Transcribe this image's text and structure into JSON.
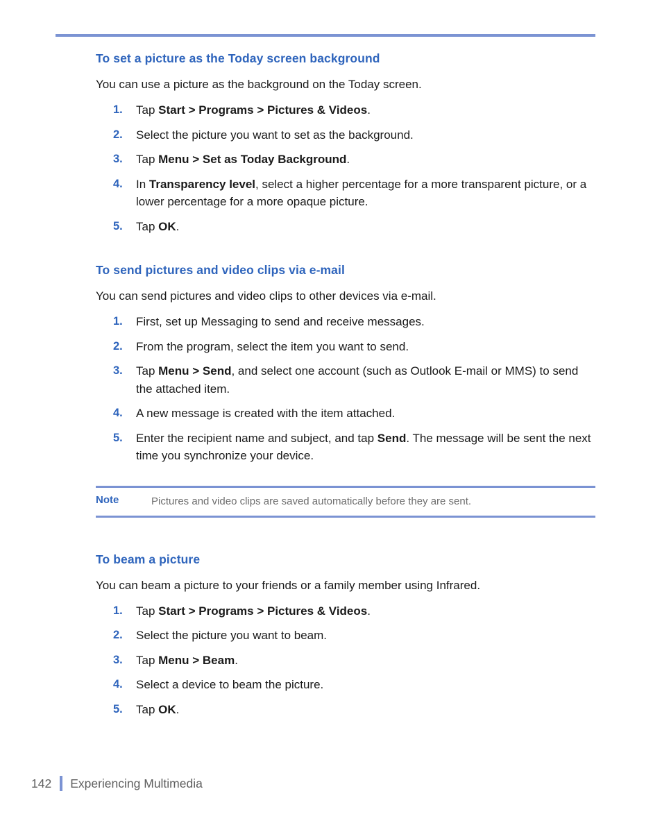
{
  "document": {
    "sections": [
      {
        "heading": "To set a picture as the Today screen background",
        "intro": "You can use a picture as the background on the Today screen.",
        "steps": [
          {
            "num": "1.",
            "parts": [
              {
                "text": "Tap ",
                "bold": false
              },
              {
                "text": "Start > Programs > Pictures & Videos",
                "bold": true
              },
              {
                "text": ".",
                "bold": false
              }
            ]
          },
          {
            "num": "2.",
            "parts": [
              {
                "text": "Select the picture you want to set as the background.",
                "bold": false
              }
            ]
          },
          {
            "num": "3.",
            "parts": [
              {
                "text": "Tap ",
                "bold": false
              },
              {
                "text": "Menu > Set as Today Background",
                "bold": true
              },
              {
                "text": ".",
                "bold": false
              }
            ]
          },
          {
            "num": "4.",
            "parts": [
              {
                "text": "In ",
                "bold": false
              },
              {
                "text": "Transparency level",
                "bold": true
              },
              {
                "text": ", select a higher percentage for a more transparent picture, or a lower percentage for a more opaque picture.",
                "bold": false
              }
            ]
          },
          {
            "num": "5.",
            "parts": [
              {
                "text": "Tap ",
                "bold": false
              },
              {
                "text": "OK",
                "bold": true
              },
              {
                "text": ".",
                "bold": false
              }
            ]
          }
        ]
      },
      {
        "heading": "To send pictures and video clips via e-mail",
        "intro": "You can send pictures and video clips to other devices via e-mail.",
        "steps": [
          {
            "num": "1.",
            "parts": [
              {
                "text": "First, set up Messaging to send and receive messages.",
                "bold": false
              }
            ]
          },
          {
            "num": "2.",
            "parts": [
              {
                "text": "From the program, select the item you want to send.",
                "bold": false
              }
            ]
          },
          {
            "num": "3.",
            "parts": [
              {
                "text": "Tap ",
                "bold": false
              },
              {
                "text": "Menu > Send",
                "bold": true
              },
              {
                "text": ", and select one account (such as Outlook E-mail or MMS) to send the attached item.",
                "bold": false
              }
            ]
          },
          {
            "num": "4.",
            "parts": [
              {
                "text": "A new message is created with the item attached.",
                "bold": false
              }
            ]
          },
          {
            "num": "5.",
            "parts": [
              {
                "text": "Enter the recipient name and subject, and tap ",
                "bold": false
              },
              {
                "text": "Send",
                "bold": true
              },
              {
                "text": ". The message will be sent the next time you synchronize your device.",
                "bold": false
              }
            ]
          }
        ]
      },
      {
        "heading": "To beam a picture",
        "intro": "You can beam a picture to your friends or a family member using Infrared.",
        "steps": [
          {
            "num": "1.",
            "parts": [
              {
                "text": "Tap ",
                "bold": false
              },
              {
                "text": "Start > Programs > Pictures & Videos",
                "bold": true
              },
              {
                "text": ".",
                "bold": false
              }
            ]
          },
          {
            "num": "2.",
            "parts": [
              {
                "text": "Select the picture you want to beam.",
                "bold": false
              }
            ]
          },
          {
            "num": "3.",
            "parts": [
              {
                "text": "Tap ",
                "bold": false
              },
              {
                "text": "Menu > Beam",
                "bold": true
              },
              {
                "text": ".",
                "bold": false
              }
            ]
          },
          {
            "num": "4.",
            "parts": [
              {
                "text": "Select a device to beam the picture.",
                "bold": false
              }
            ]
          },
          {
            "num": "5.",
            "parts": [
              {
                "text": "Tap ",
                "bold": false
              },
              {
                "text": "OK",
                "bold": true
              },
              {
                "text": ".",
                "bold": false
              }
            ]
          }
        ]
      }
    ],
    "note": {
      "label": "Note",
      "text": "Pictures and video clips are saved automatically before they are sent."
    },
    "footer": {
      "page_number": "142",
      "chapter": "Experiencing Multimedia"
    },
    "colors": {
      "heading_blue": "#2e64bc",
      "rule_blue": "#7b93d3",
      "body_text": "#1a1a1a",
      "muted_text": "#6d6d6d",
      "footer_text": "#5e5e5e"
    }
  }
}
